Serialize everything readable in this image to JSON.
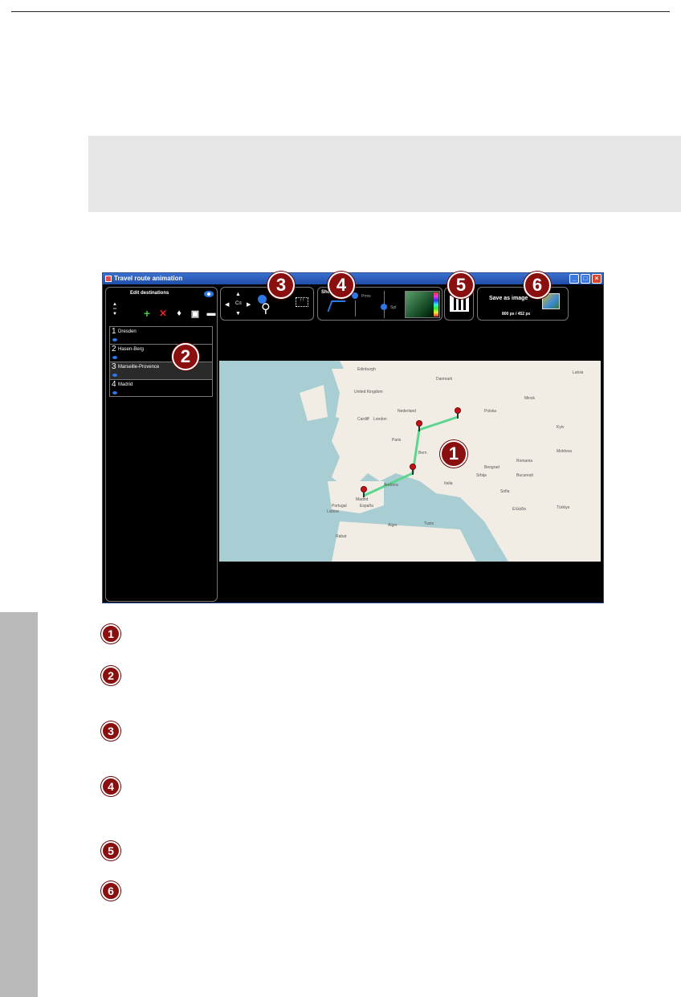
{
  "window": {
    "title": "Travel route animation",
    "controls": [
      "_",
      "□",
      "×"
    ]
  },
  "destinations_panel": {
    "title": "Edit destinations",
    "toolbar_icons": [
      "add-icon",
      "delete-icon",
      "pin-icon",
      "save-icon",
      "folder-icon"
    ],
    "items": [
      {
        "number": "1",
        "name": "Dresden"
      },
      {
        "number": "2",
        "name": "Hasen-Berg"
      },
      {
        "number": "3",
        "name": "Marseille-Provence"
      },
      {
        "number": "4",
        "name": "Madrid"
      }
    ]
  },
  "navigation": {
    "arrows": [
      "▲",
      "◀",
      "▶",
      "▼"
    ],
    "coord_label": "C≡"
  },
  "show_panel": {
    "label": "Show",
    "point_label_top": "Prms",
    "point_label_bottom": "Spt"
  },
  "save_panel": {
    "label": "Save as image",
    "dimensions": "800 px / 452 px"
  },
  "map": {
    "labels": [
      "Edinburgh",
      "United Kingdom",
      "Cardiff",
      "London",
      "Danmark",
      "Latvia",
      "Nederland",
      "Polska",
      "Minsk",
      "Kyiv",
      "Moldova",
      "Romania",
      "București",
      "Sofia",
      "Italia",
      "Beograd",
      "Srbija",
      "Portugal",
      "Lisboa",
      "España",
      "Andorra",
      "Ελλάδα",
      "Türkiye",
      "Tunis",
      "Alger",
      "Rabat",
      "Madrid",
      "Paris",
      "Bern"
    ]
  },
  "callouts": [
    "1",
    "2",
    "3",
    "4",
    "5",
    "6"
  ]
}
